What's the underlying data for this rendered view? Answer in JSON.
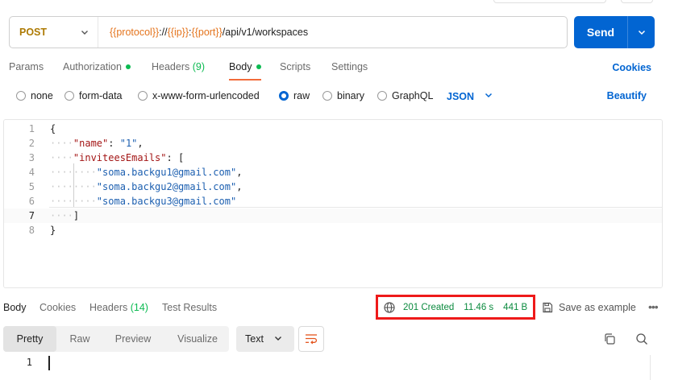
{
  "request": {
    "method": "POST",
    "url": {
      "parts": [
        "{{protocol}}",
        "://",
        "{{ip}}",
        ":",
        "{{port}}",
        "/api/v1/workspaces"
      ]
    },
    "send_label": "Send"
  },
  "request_tabs": {
    "params": "Params",
    "authorization": "Authorization",
    "headers": "Headers",
    "headers_count": "(9)",
    "body": "Body",
    "scripts": "Scripts",
    "settings": "Settings",
    "cookies": "Cookies"
  },
  "body_types": {
    "none": "none",
    "form_data": "form-data",
    "urlencoded": "x-www-form-urlencoded",
    "raw": "raw",
    "binary": "binary",
    "graphql": "GraphQL",
    "language": "JSON",
    "beautify": "Beautify",
    "selected": "raw"
  },
  "editor": {
    "line_numbers": [
      "1",
      "2",
      "3",
      "4",
      "5",
      "6",
      "7",
      "8"
    ],
    "lines": [
      {
        "indent": "",
        "tokens": [
          {
            "t": "p",
            "v": "{"
          }
        ]
      },
      {
        "indent": "····",
        "tokens": [
          {
            "t": "k",
            "v": "\"name\""
          },
          {
            "t": "p",
            "v": ": "
          },
          {
            "t": "s",
            "v": "\"1\""
          },
          {
            "t": "p",
            "v": ","
          }
        ]
      },
      {
        "indent": "····",
        "tokens": [
          {
            "t": "k",
            "v": "\"inviteesEmails\""
          },
          {
            "t": "p",
            "v": ": ["
          }
        ]
      },
      {
        "indent": "········",
        "tokens": [
          {
            "t": "s",
            "v": "\"soma.backgu1@gmail.com\""
          },
          {
            "t": "p",
            "v": ","
          }
        ]
      },
      {
        "indent": "········",
        "tokens": [
          {
            "t": "s",
            "v": "\"soma.backgu2@gmail.com\""
          },
          {
            "t": "p",
            "v": ","
          }
        ]
      },
      {
        "indent": "········",
        "tokens": [
          {
            "t": "s",
            "v": "\"soma.backgu3@gmail.com\""
          }
        ]
      },
      {
        "indent": "····",
        "tokens": [
          {
            "t": "p",
            "v": "]"
          }
        ]
      },
      {
        "indent": "",
        "tokens": [
          {
            "t": "p",
            "v": "}"
          }
        ]
      }
    ],
    "current_line": 7
  },
  "response_tabs": {
    "body": "Body",
    "cookies": "Cookies",
    "headers": "Headers",
    "headers_count": "(14)",
    "test_results": "Test Results"
  },
  "response_status": {
    "status": "201 Created",
    "time": "11.46 s",
    "size": "441 B"
  },
  "save_example": "Save as example",
  "more": "•••",
  "view_modes": {
    "pretty": "Pretty",
    "raw": "Raw",
    "preview": "Preview",
    "visualize": "Visualize",
    "format": "Text"
  },
  "response_editor": {
    "line_numbers": [
      "1"
    ]
  },
  "colors": {
    "accent": "#0265d2",
    "method": "#ad7a03",
    "variable": "#e4741d",
    "success": "#0cbb52",
    "highlight_box": "#ee1a1a"
  }
}
